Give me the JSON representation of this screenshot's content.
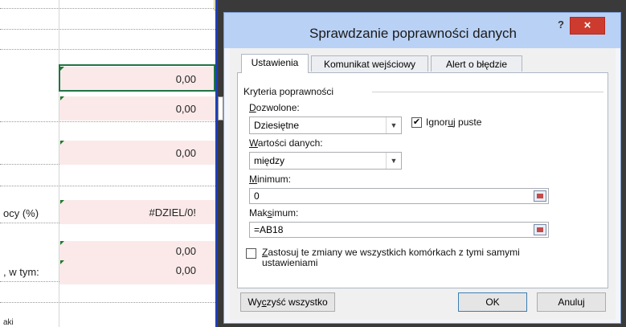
{
  "sheet": {
    "values": [
      "0,00",
      "0,00",
      "0,00",
      "#DZIEL/0!",
      "0,00",
      "0,00"
    ],
    "labels": [
      "ocy (%)",
      ", w tym:",
      "aki"
    ]
  },
  "dialog": {
    "title": "Sprawdzanie poprawności danych",
    "help": "?",
    "close": "×",
    "tabs": [
      "Ustawienia",
      "Komunikat wejściowy",
      "Alert o błędzie"
    ],
    "section": "Kryteria poprawności",
    "allow": {
      "label_pre": "",
      "label_u": "D",
      "label_post": "ozwolone:",
      "value": "Dziesiętne"
    },
    "ignore_blank": {
      "label_pre": "Ignor",
      "label_u": "u",
      "label_post": "j puste",
      "checked": true
    },
    "data": {
      "label_pre": "",
      "label_u": "W",
      "label_post": "artości danych:",
      "value": "między"
    },
    "minimum": {
      "label_pre": "",
      "label_u": "M",
      "label_post": "inimum:",
      "value": "0"
    },
    "maximum": {
      "label_pre": "Mak",
      "label_u": "s",
      "label_post": "imum:",
      "value": "=AB18"
    },
    "apply_all": {
      "label_pre": "",
      "label_u": "Z",
      "label_post": "astosuj te zmiany we wszystkich komórkach z tymi samymi",
      "label_line2": "ustawieniami",
      "checked": false
    },
    "buttons": {
      "clear_pre": "Wy",
      "clear_u": "c",
      "clear_post": "zyść wszystko",
      "ok": "OK",
      "cancel": "Anuluj"
    }
  },
  "colors": {
    "titlebar": "#b9d1f5",
    "close": "#cd3b2f",
    "cell_fill": "#fbe9e9",
    "selection": "#217346",
    "divider": "#1f3fb5"
  }
}
